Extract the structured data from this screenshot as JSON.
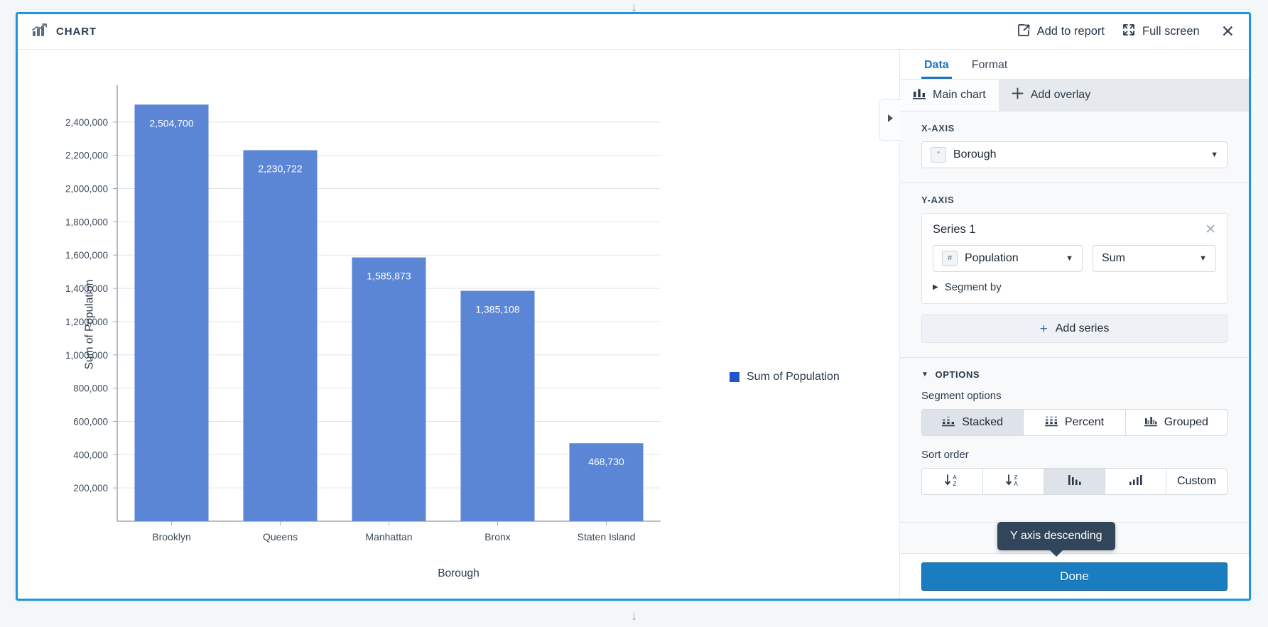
{
  "window": {
    "top_resize_icon": "arrow-down-icon",
    "bottom_resize_icon": "arrow-down-icon"
  },
  "header": {
    "icon": "chart-bar-growth-icon",
    "title": "CHART",
    "add_to_report": "Add to report",
    "add_to_report_icon": "external-link-icon",
    "full_screen": "Full screen",
    "full_screen_icon": "expand-icon",
    "close_icon": "close-icon"
  },
  "chart_data": {
    "type": "bar",
    "title": "",
    "categories": [
      "Brooklyn",
      "Queens",
      "Manhattan",
      "Bronx",
      "Staten Island"
    ],
    "values": [
      2504700,
      2230722,
      1585873,
      1385108,
      468730
    ],
    "value_labels": [
      "2,504,700",
      "2,230,722",
      "1,585,873",
      "1,385,108",
      "468,730"
    ],
    "series": [
      {
        "name": "Sum of Population",
        "values": [
          2504700,
          2230722,
          1585873,
          1385108,
          468730
        ]
      }
    ],
    "xlabel": "Borough",
    "ylabel": "Sum of Population",
    "ylim": [
      0,
      2600000
    ],
    "ytick_labels": [
      "200,000",
      "400,000",
      "600,000",
      "800,000",
      "1,000,000",
      "1,200,000",
      "1,400,000",
      "1,600,000",
      "1,800,000",
      "2,000,000",
      "2,200,000",
      "2,400,000"
    ],
    "ytick_values": [
      200000,
      400000,
      600000,
      800000,
      1000000,
      1200000,
      1400000,
      1600000,
      1800000,
      2000000,
      2200000,
      2400000
    ],
    "grid": true,
    "legend_position": "right",
    "legend_entries": [
      "Sum of Population"
    ],
    "bar_color": "#5b86d6",
    "legend_swatch_color": "#2255cc"
  },
  "collapse_tab": {
    "icon": "triangle-right-icon"
  },
  "sidebar": {
    "tabs": [
      {
        "label": "Data",
        "active": true
      },
      {
        "label": "Format",
        "active": false
      }
    ],
    "subtabs": [
      {
        "label": "Main chart",
        "icon": "bar-chart-icon",
        "active": true
      },
      {
        "label": "Add overlay",
        "icon": "plus-icon",
        "active": false
      }
    ],
    "x_axis": {
      "label": "X-AXIS",
      "field": "Borough",
      "field_type_icon": "string-quote-icon",
      "caret_icon": "chevron-down-icon"
    },
    "y_axis": {
      "label": "Y-AXIS",
      "series_title": "Series 1",
      "remove_icon": "close-icon",
      "field": "Population",
      "field_type_icon": "number-hash-icon",
      "aggregation": "Sum",
      "caret_icon": "chevron-down-icon",
      "segment_by": "Segment by",
      "segment_by_icon": "triangle-right-icon",
      "add_series": "Add series",
      "add_series_icon": "plus-icon"
    },
    "options": {
      "label": "OPTIONS",
      "collapse_icon": "triangle-down-icon",
      "segment_options_label": "Segment options",
      "segment_buttons": [
        {
          "label": "Stacked",
          "icon": "stacked-bars-icon",
          "selected": true
        },
        {
          "label": "Percent",
          "icon": "percent-bars-icon",
          "selected": false
        },
        {
          "label": "Grouped",
          "icon": "grouped-bars-icon",
          "selected": false
        }
      ],
      "sort_order_label": "Sort order",
      "sort_buttons": [
        {
          "label": "",
          "icon": "sort-a-z-icon",
          "selected": false
        },
        {
          "label": "",
          "icon": "sort-z-a-icon",
          "selected": false
        },
        {
          "label": "",
          "icon": "y-axis-descending-icon",
          "selected": true
        },
        {
          "label": "",
          "icon": "y-axis-ascending-icon",
          "selected": false
        },
        {
          "label": "Custom",
          "icon": "",
          "selected": false
        }
      ]
    },
    "footer": {
      "done": "Done"
    }
  },
  "tooltip": {
    "text": "Y axis descending"
  },
  "colors": {
    "accent": "#2196d6",
    "primary_button": "#1a7dc0",
    "bar": "#5b86d6",
    "tooltip_bg": "#31465a",
    "tab_active": "#1a73c0"
  }
}
